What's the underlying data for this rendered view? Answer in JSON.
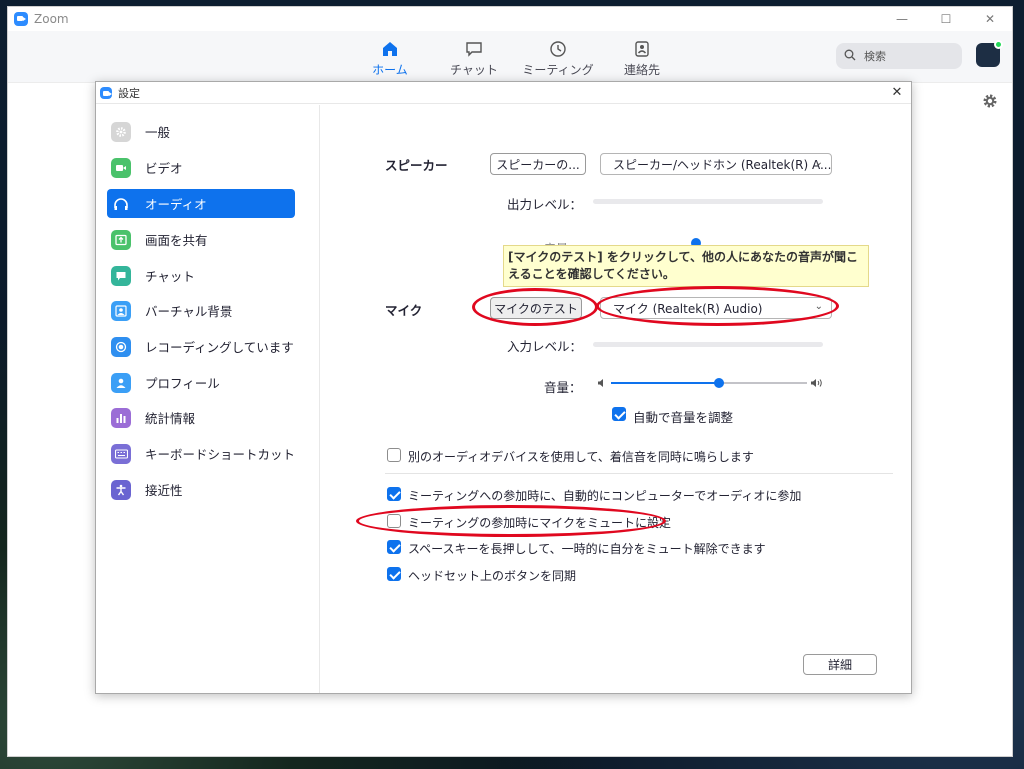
{
  "app": {
    "title": "Zoom"
  },
  "window_controls": {
    "minimize": "—",
    "maximize": "☐",
    "close": "✕"
  },
  "nav": {
    "tabs": [
      {
        "label": "ホーム",
        "icon": "home-icon",
        "active": true
      },
      {
        "label": "チャット",
        "icon": "chat-icon"
      },
      {
        "label": "ミーティング",
        "icon": "clock-icon"
      },
      {
        "label": "連絡先",
        "icon": "contact-icon"
      }
    ],
    "search_placeholder": "検索"
  },
  "dialog": {
    "title": "設定",
    "close": "✕",
    "sidebar": [
      {
        "label": "一般",
        "icon": "gear-icon",
        "color": "#d6d6d6"
      },
      {
        "label": "ビデオ",
        "icon": "camera-icon",
        "color": "#4ac26b"
      },
      {
        "label": "オーディオ",
        "icon": "headphones-icon",
        "active": true
      },
      {
        "label": "画面を共有",
        "icon": "share-screen-icon",
        "color": "#4ac26b"
      },
      {
        "label": "チャット",
        "icon": "chat-bubble-icon",
        "color": "#34b59a"
      },
      {
        "label": "バーチャル背景",
        "icon": "person-frame-icon",
        "color": "#3b9ff6"
      },
      {
        "label": "レコーディングしています",
        "icon": "record-icon",
        "color": "#2f8ff0"
      },
      {
        "label": "プロフィール",
        "icon": "profile-icon",
        "color": "#3b9ff6"
      },
      {
        "label": "統計情報",
        "icon": "statistics-icon",
        "color": "#9b6dd6"
      },
      {
        "label": "キーボードショートカット",
        "icon": "keyboard-icon",
        "color": "#7a6fd6"
      },
      {
        "label": "接近性",
        "icon": "accessibility-icon",
        "color": "#6a64d1"
      }
    ],
    "audio": {
      "speaker_label": "スピーカー",
      "speaker_test_button": "スピーカーの...",
      "speaker_select": "スピーカー/ヘッドホン (Realtek(R) A...",
      "output_level_label": "出力レベル：",
      "hidden_volume_label": "音量：",
      "tooltip": "[マイクのテスト] をクリックして、他の人にあなたの音声が聞こえることを確認してください。",
      "mic_label": "マイク",
      "mic_test_button": "マイクのテスト",
      "mic_select": "マイク (Realtek(R) Audio)",
      "input_level_label": "入力レベル：",
      "volume_label": "音量：",
      "volume_value": 0.55,
      "auto_adjust_label": "自動で音量を調整",
      "auto_adjust_checked": true,
      "ringtone_label": "別のオーディオデバイスを使用して、着信音を同時に鳴らします",
      "ringtone_checked": false,
      "options": [
        {
          "label": "ミーティングへの参加時に、自動的にコンピューターでオーディオに参加",
          "checked": true
        },
        {
          "label": "ミーティングの参加時にマイクをミュートに設定",
          "checked": false
        },
        {
          "label": "スペースキーを長押しして、一時的に自分をミュート解除できます",
          "checked": true
        },
        {
          "label": "ヘッドセット上のボタンを同期",
          "checked": true
        }
      ],
      "advanced_button": "詳細"
    }
  },
  "colors": {
    "accent": "#0e72ed",
    "annotation": "#e0081f"
  }
}
